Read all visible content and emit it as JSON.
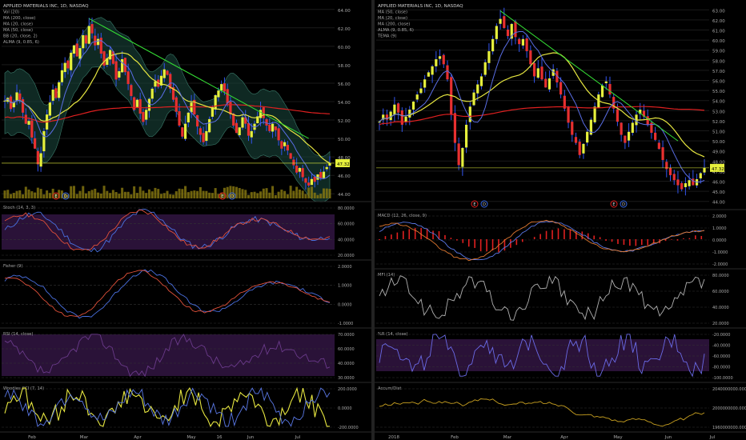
{
  "colors": {
    "bg": "#000000",
    "grid": "#1a1a1a",
    "text": "#a8a8a8",
    "sep": "#2a2a2a",
    "up": "#e6f03c",
    "down": "#e83030",
    "wick": "#3355ee",
    "ma50": "#e6e640",
    "ma20": "#5a6ee6",
    "ma200": "#e02020",
    "trend": "#35e035",
    "bb": "#1c4a40",
    "price_tag": "#e6f03c",
    "purple": "#2a1238",
    "stoch_k": "#4a70e0",
    "stoch_d": "#e0503a",
    "macd": "#5a78e6",
    "signal": "#e07830",
    "hist_up": "#e02020",
    "hist_dn": "#e02020",
    "mfi": "#b0b0b0",
    "willr": "#6a6ae6",
    "accdist": "#c8a020",
    "cci_fill": "#e6e640",
    "cci_line": "#5a78e6"
  },
  "left": {
    "legend": [
      "APPLIED MATERIALS INC, 1D, NASDAQ",
      "Vol (20)",
      "MA (200, close)",
      "MA (20, close)",
      "MA (50, close)",
      "BB (20, close, 2)",
      "ALMA (9, 0.85, 6)"
    ],
    "yticks": [
      "64.00",
      "62.00",
      "60.00",
      "58.00",
      "56.00",
      "54.00",
      "52.00",
      "50.00",
      "48.00",
      "46.00",
      "44.00"
    ],
    "price_tag": "47.32",
    "events": [
      {
        "label": "E"
      },
      {
        "label": "D"
      },
      {
        "label": "E"
      },
      {
        "label": "D"
      }
    ],
    "xticks": [
      "Feb",
      "Mar",
      "Apr",
      "May",
      "16",
      "Jun",
      "Jul"
    ],
    "panes": [
      {
        "title": "Stoch (14, 3, 3)",
        "ticks": [
          "80.0000",
          "60.0000",
          "40.0000",
          "20.0000"
        ]
      },
      {
        "title": "Fisher (9)",
        "ticks": [
          "2.0000",
          "1.0000",
          "0.0000",
          "-1.0000"
        ]
      },
      {
        "title": "RSI (14, close)",
        "ticks": [
          "70.0000",
          "60.0000",
          "40.0000",
          "30.0000"
        ]
      },
      {
        "title": "Woodies CCI (7, 14)",
        "ticks": [
          "200.0000",
          "0.0000",
          "-200.0000"
        ]
      }
    ]
  },
  "right": {
    "legend": [
      "APPLIED MATERIALS INC, 1D, NASDAQ",
      "MA (50, close)",
      "MA (20, close)",
      "MA (200, close)",
      "ALMA (9, 0.85, 6)",
      "TEMA (9)"
    ],
    "yticks": [
      "63.00",
      "62.00",
      "61.00",
      "60.00",
      "59.00",
      "58.00",
      "57.00",
      "56.00",
      "55.00",
      "54.00",
      "53.00",
      "52.00",
      "51.00",
      "50.00",
      "49.00",
      "48.00",
      "47.00",
      "46.00",
      "45.00",
      "44.00"
    ],
    "price_tag": "47.32",
    "events": [
      {
        "label": "E"
      },
      {
        "label": "D"
      },
      {
        "label": "E"
      },
      {
        "label": "D"
      }
    ],
    "xticks": [
      "2018",
      "Feb",
      "Mar",
      "Apr",
      "May",
      "Jun",
      "Jul"
    ],
    "panes": [
      {
        "title": "MACD (12, 26, close, 9)",
        "ticks": [
          "2.0000",
          "1.0000",
          "0.0000",
          "-1.0000",
          "-2.0000"
        ]
      },
      {
        "title": "MFI (14)",
        "ticks": [
          "80.0000",
          "60.0000",
          "40.0000",
          "20.0000"
        ]
      },
      {
        "title": "%R (14, close)",
        "ticks": [
          "-20.0000",
          "-40.0000",
          "-60.0000",
          "-80.0000",
          "-100.0000"
        ]
      },
      {
        "title": "Accum/Dist",
        "ticks": [
          "2040000000.0000",
          "2000000000.0000",
          "1960000000.0000"
        ]
      }
    ]
  },
  "chart_data": [
    {
      "type": "candlestick",
      "title": "APPLIED MATERIALS INC, 1D, NASDAQ",
      "ylim": [
        43.5,
        64.5
      ],
      "close": [
        54.1,
        54.4,
        53.2,
        53.9,
        55.0,
        54.2,
        52.8,
        51.6,
        51.9,
        50.1,
        48.9,
        47.2,
        48.4,
        50.8,
        52.6,
        53.9,
        55.3,
        54.4,
        56.1,
        57.4,
        58.2,
        57.6,
        59.3,
        60.1,
        58.9,
        59.8,
        61.2,
        60.3,
        62.2,
        61.4,
        60.1,
        60.8,
        59.2,
        57.9,
        58.7,
        59.6,
        58.1,
        56.4,
        57.3,
        58.6,
        57.2,
        55.9,
        54.6,
        53.1,
        54.2,
        52.7,
        51.8,
        53.1,
        54.3,
        55.4,
        56.2,
        55.6,
        56.8,
        57.5,
        56.9,
        55.4,
        54.2,
        52.9,
        51.4,
        50.2,
        51.6,
        52.8,
        53.9,
        52.6,
        51.3,
        50.4,
        49.6,
        50.8,
        52.1,
        53.4,
        54.7,
        55.2,
        55.9,
        55.1,
        53.8,
        52.6,
        51.4,
        50.6,
        51.2,
        52.3,
        51.6,
        50.3,
        50.8,
        51.6,
        52.4,
        53.1,
        52.2,
        51.4,
        50.8,
        51.6,
        50.9,
        49.8,
        48.9,
        49.6,
        48.7,
        47.8,
        47.1,
        46.3,
        46.8,
        45.8,
        45.2,
        44.9,
        45.6,
        45.3,
        46.1,
        45.7,
        46.4,
        46.9,
        47.32
      ]
    },
    {
      "type": "candlestick",
      "title": "APPLIED MATERIALS INC, 1D, NASDAQ",
      "ylim": [
        43.5,
        63.5
      ],
      "close": [
        51.9,
        52.6,
        52.1,
        52.9,
        53.6,
        52.8,
        51.6,
        52.4,
        53.1,
        53.9,
        54.6,
        55.2,
        56.1,
        56.8,
        57.4,
        58.1,
        58.4,
        57.6,
        56.1,
        52.6,
        49.8,
        47.6,
        49.3,
        51.6,
        53.4,
        54.8,
        55.6,
        56.4,
        57.8,
        58.9,
        60.1,
        61.4,
        62.1,
        61.2,
        60.4,
        61.6,
        60.3,
        59.6,
        60.1,
        58.9,
        57.6,
        56.4,
        57.2,
        56.1,
        55.3,
        56.2,
        57.1,
        55.8,
        54.6,
        53.2,
        51.8,
        50.6,
        49.8,
        48.6,
        49.7,
        50.9,
        52.1,
        53.4,
        54.6,
        55.5,
        55.9,
        54.6,
        53.2,
        51.9,
        50.6,
        49.8,
        50.9,
        51.8,
        52.6,
        53.1,
        52.4,
        51.6,
        50.8,
        50.1,
        49.2,
        48.1,
        47.2,
        46.6,
        46.1,
        45.6,
        45.2,
        45.8,
        46.1,
        45.6,
        46.2,
        46.8,
        47.32
      ]
    }
  ]
}
